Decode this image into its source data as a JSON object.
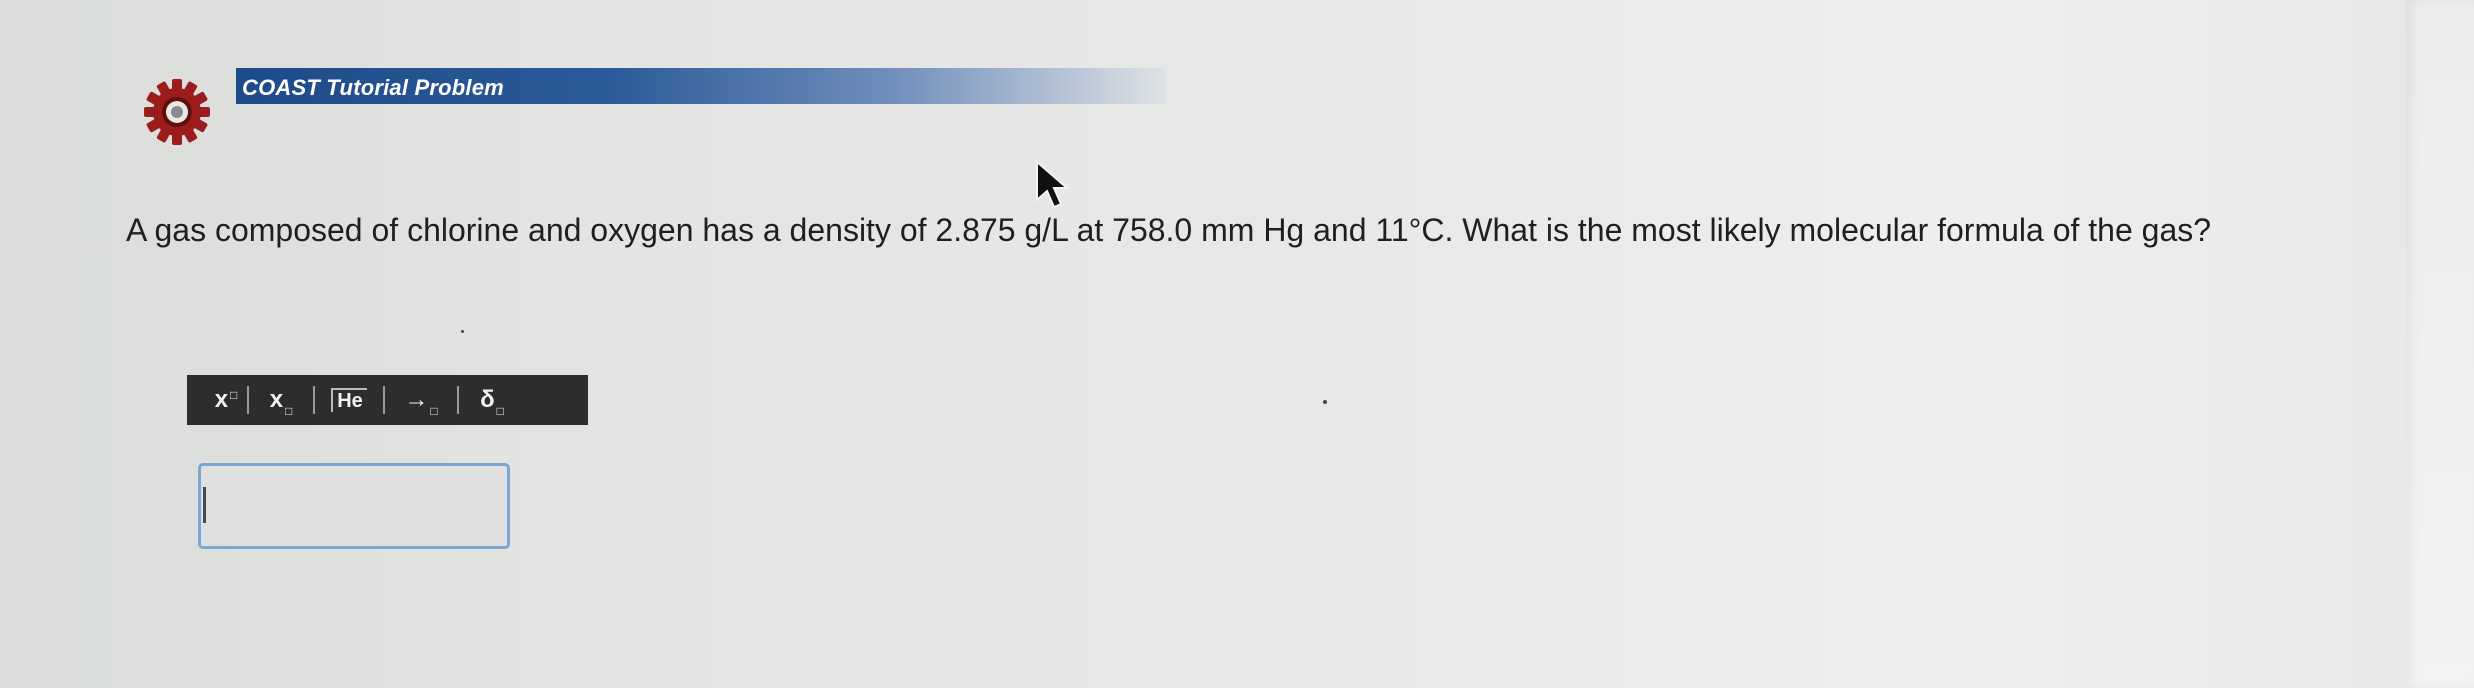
{
  "header": {
    "title": "COAST Tutorial Problem",
    "icon": "gear-icon",
    "banner_color": "#2b5a98",
    "gear_color": "#9b1c1c"
  },
  "question": {
    "text": "A gas composed of chlorine and oxygen has a density of 2.875 g/L at 758.0 mm Hg and 11°C. What is the most likely molecular formula of the gas?"
  },
  "toolbar": {
    "buttons": [
      {
        "label": "x",
        "icon": "superscript-icon"
      },
      {
        "label": "x",
        "icon": "subscript-icon"
      },
      {
        "label": "He",
        "icon": "element-icon"
      },
      {
        "label": "→",
        "icon": "reaction-arrow-icon"
      },
      {
        "label": "δ",
        "icon": "partial-charge-icon"
      }
    ],
    "background": "#2d2d2d"
  },
  "answer": {
    "value": "",
    "border_color": "#79a7d6"
  }
}
